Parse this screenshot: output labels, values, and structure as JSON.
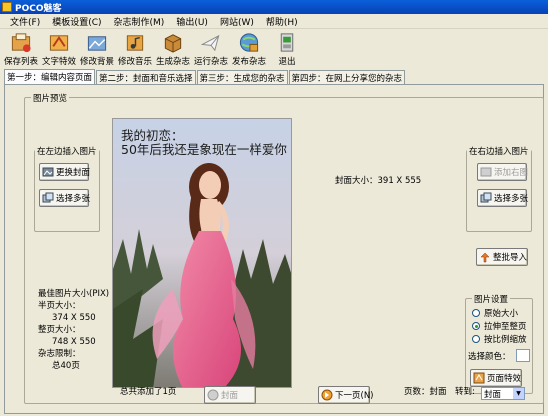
{
  "window": {
    "title": "POCO魅客"
  },
  "menu": [
    "文件(F)",
    "模板设置(C)",
    "杂志制作(M)",
    "输出(U)",
    "网站(W)",
    "帮助(H)"
  ],
  "toolbar": [
    {
      "label": "保存列表",
      "icon": "save-list-icon"
    },
    {
      "label": "文字特效",
      "icon": "text-effect-icon"
    },
    {
      "label": "修改背景",
      "icon": "background-icon"
    },
    {
      "label": "修改音乐",
      "icon": "music-icon"
    },
    {
      "label": "生成杂志",
      "icon": "generate-icon"
    },
    {
      "label": "运行杂志",
      "icon": "run-icon"
    },
    {
      "label": "发布杂志",
      "icon": "publish-icon"
    },
    {
      "label": "退出",
      "icon": "exit-icon"
    }
  ],
  "tabs": [
    "第一步：编辑内容页面",
    "第二步：封面和音乐选择",
    "第三步：生成您的杂志",
    "第四步：在网上分享您的杂志"
  ],
  "preview": {
    "group_title": "图片预览",
    "caption_line1": "我的初恋：",
    "caption_line2": "50年后我还是象现在一样爱你",
    "cover_size_label": "封面大小：391 X 555"
  },
  "left_insert": {
    "title": "在左边插入图片",
    "replace_cover": "更换封面",
    "select_many": "选择多张"
  },
  "right_insert": {
    "title": "在右边插入图片",
    "add_right": "添加右图",
    "select_many": "选择多张"
  },
  "batch_import": "整批导入",
  "best_size": {
    "title": "最佳图片大小(PIX)",
    "half_label": "半页大小：",
    "half_value": "374 X 550",
    "full_label": "整页大小：",
    "full_value": "748 X 550",
    "limit_label": "杂志限制：",
    "limit_value": "总40页"
  },
  "image_settings": {
    "title": "图片设置",
    "options": [
      "原始大小",
      "拉伸至整页",
      "按比例缩放"
    ],
    "selected": 1,
    "color_label": "选择颜色：",
    "effect_button": "页面特效"
  },
  "footer": {
    "added_count": "总共添加了1页",
    "cover_button": "封面",
    "next_button": "下一页(N)",
    "page_label": "页数：封面",
    "goto_label": "转到:",
    "goto_value": "封面"
  }
}
